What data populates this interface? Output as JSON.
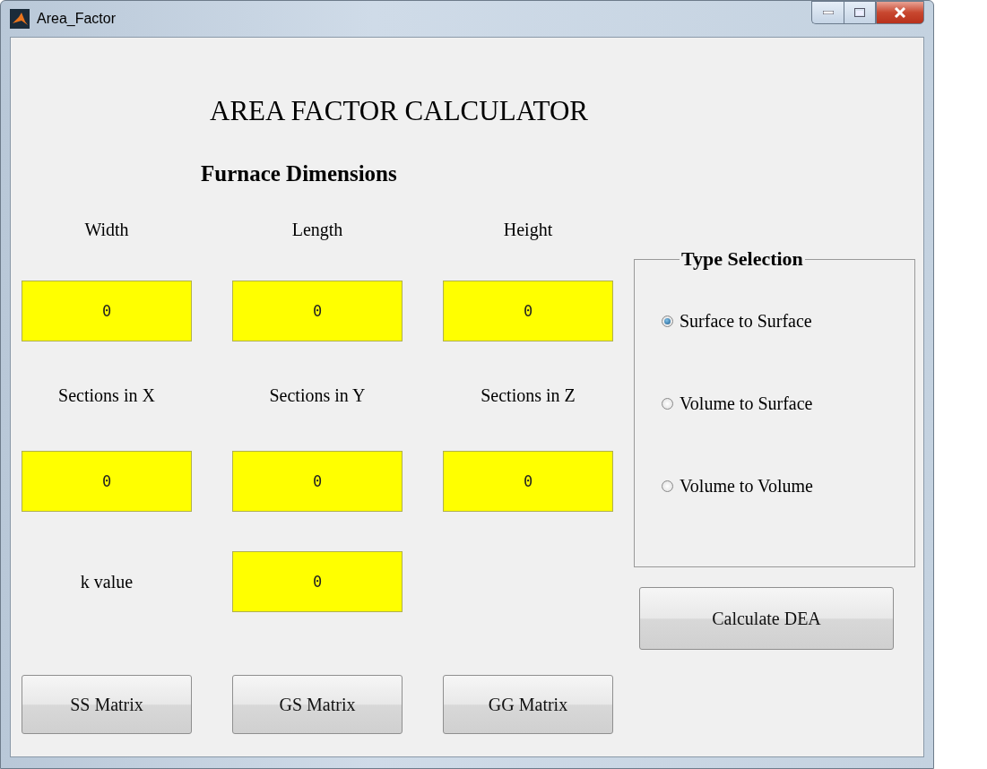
{
  "window": {
    "title": "Area_Factor"
  },
  "heading": "AREA FACTOR CALCULATOR",
  "section_title": "Furnace Dimensions",
  "dimension_fields": [
    {
      "label": "Width",
      "value": "0"
    },
    {
      "label": "Length",
      "value": "0"
    },
    {
      "label": "Height",
      "value": "0"
    },
    {
      "label": "Sections in X",
      "value": "0"
    },
    {
      "label": "Sections in Y",
      "value": "0"
    },
    {
      "label": "Sections in Z",
      "value": "0"
    }
  ],
  "k_field": {
    "label": "k value",
    "value": "0"
  },
  "type_selection": {
    "title": "Type Selection",
    "options": [
      {
        "label": "Surface to Surface",
        "selected": true
      },
      {
        "label": "Volume to Surface",
        "selected": false
      },
      {
        "label": "Volume to Volume",
        "selected": false
      }
    ]
  },
  "calculate_button": "Calculate DEA",
  "matrix_buttons": [
    "SS Matrix",
    "GS Matrix",
    "GG Matrix"
  ]
}
